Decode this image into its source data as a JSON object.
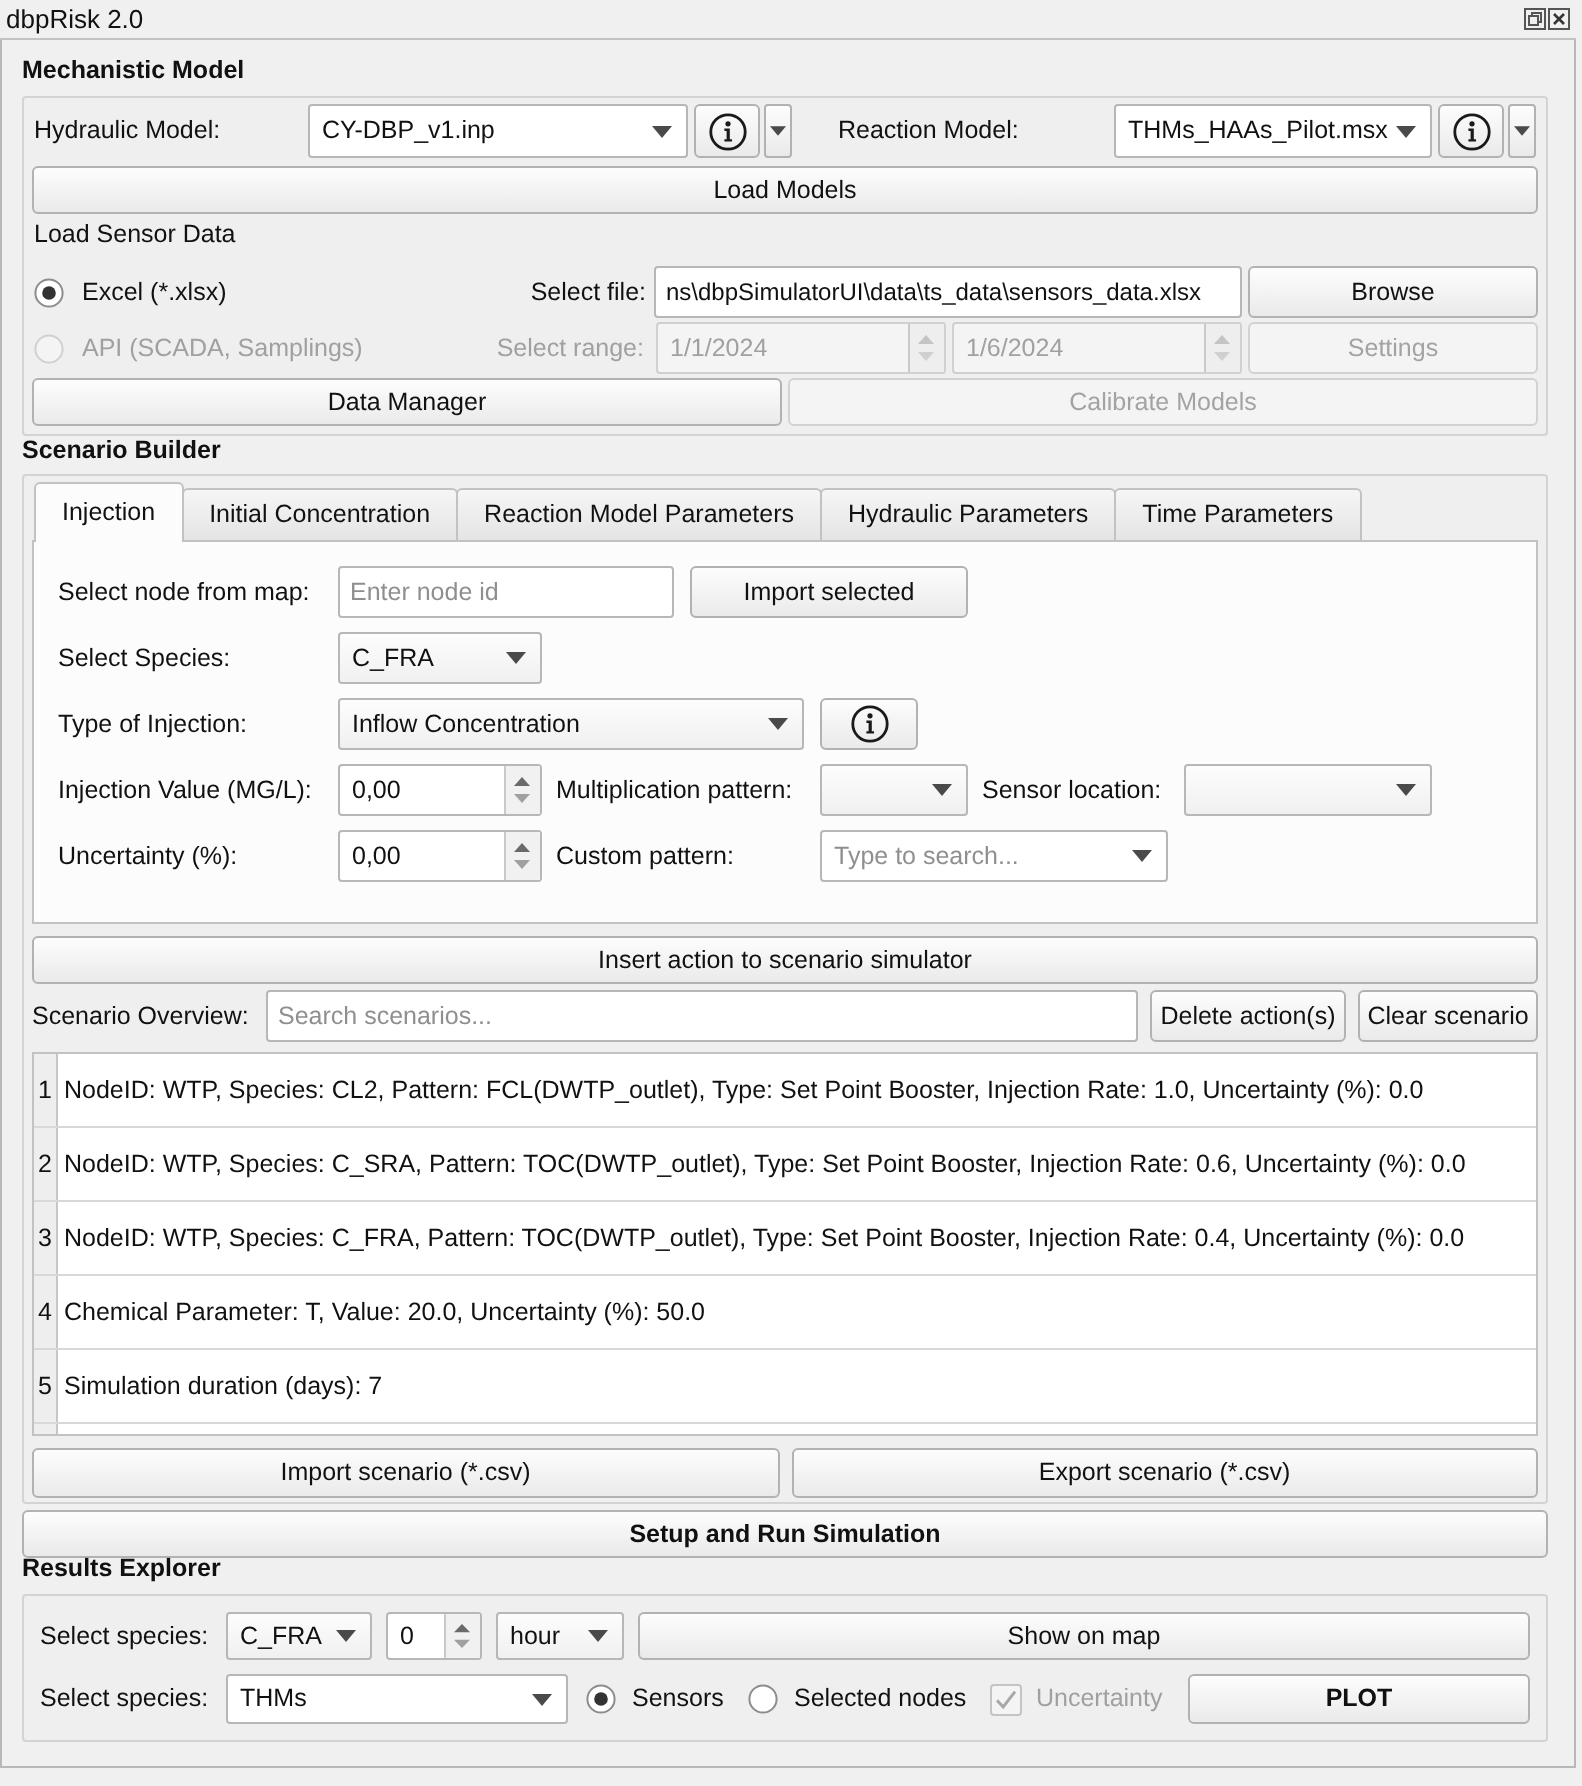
{
  "window": {
    "title": "dbpRisk 2.0"
  },
  "mechanistic_model": {
    "title": "Mechanistic Model",
    "hydraulic_model": {
      "label": "Hydraulic Model:",
      "value": "CY-DBP_v1.inp"
    },
    "reaction_model": {
      "label": "Reaction Model:",
      "value": "THMs_HAAs_Pilot.msx"
    },
    "load_button": "Load Models",
    "sensor_data": {
      "title": "Load Sensor Data",
      "sources": [
        {
          "label": "Excel (*.xlsx)",
          "selected": true,
          "disabled": false
        },
        {
          "label": "API (SCADA, Samplings)",
          "selected": false,
          "disabled": true
        }
      ],
      "file": {
        "label": "Select file:",
        "value": "ns\\dbpSimulatorUI\\data\\ts_data\\sensors_data.xlsx",
        "button": "Browse"
      },
      "range": {
        "label": "Select range:",
        "start": "1/1/2024",
        "end": "1/6/2024",
        "button": "Settings",
        "disabled": true
      }
    },
    "actions": [
      {
        "label": "Data Manager",
        "disabled": false
      },
      {
        "label": "Calibrate Models",
        "disabled": true
      }
    ]
  },
  "scenario_builder": {
    "title": "Scenario Builder",
    "tabs": [
      {
        "label": "Injection",
        "selected": true
      },
      {
        "label": "Initial Concentration",
        "selected": false
      },
      {
        "label": "Reaction Model Parameters",
        "selected": false
      },
      {
        "label": "Hydraulic Parameters",
        "selected": false
      },
      {
        "label": "Time Parameters",
        "selected": false
      }
    ],
    "injection": {
      "node": {
        "label": "Select node from map:",
        "placeholder": "Enter node id",
        "button": "Import selected"
      },
      "species": {
        "label": "Select Species:",
        "value": "C_FRA"
      },
      "injection_type": {
        "label": "Type of Injection:",
        "value": "Inflow Concentration"
      },
      "injection_value": {
        "label": "Injection Value (MG/L):",
        "value": "0,00"
      },
      "multiplication_pattern": {
        "label": "Multiplication pattern:"
      },
      "sensor_location": {
        "label": "Sensor location:"
      },
      "uncertainty": {
        "label": "Uncertainty (%):",
        "value": "0,00"
      },
      "custom_pattern": {
        "label": "Custom pattern:",
        "placeholder": "Type to search..."
      }
    },
    "insert_button": "Insert action to scenario simulator",
    "overview": {
      "label": "Scenario Overview:",
      "placeholder": "Search scenarios...",
      "delete_button": "Delete action(s)",
      "clear_button": "Clear scenario"
    },
    "rows": [
      {
        "number": "1",
        "text": "NodeID: WTP, Species: CL2, Pattern: FCL(DWTP_outlet), Type: Set Point Booster, Injection Rate: 1.0, Uncertainty (%): 0.0"
      },
      {
        "number": "2",
        "text": "NodeID: WTP, Species: C_SRA, Pattern: TOC(DWTP_outlet), Type: Set Point Booster, Injection Rate: 0.6, Uncertainty (%): 0.0"
      },
      {
        "number": "3",
        "text": "NodeID: WTP, Species: C_FRA, Pattern: TOC(DWTP_outlet), Type: Set Point Booster, Injection Rate: 0.4, Uncertainty (%): 0.0"
      },
      {
        "number": "4",
        "text": "Chemical Parameter: T, Value: 20.0, Uncertainty (%): 50.0"
      },
      {
        "number": "5",
        "text": "Simulation duration (days): 7"
      }
    ],
    "import_button": "Import scenario (*.csv)",
    "export_button": "Export scenario (*.csv)"
  },
  "run_button": "Setup and Run Simulation",
  "results_explorer": {
    "title": "Results Explorer",
    "map_row": {
      "label": "Select species:",
      "species": "C_FRA",
      "time_value": "0",
      "time_unit": "hour",
      "button": "Show on map"
    },
    "plot_row": {
      "label": "Select species:",
      "species": "THMs",
      "targets": [
        {
          "label": "Sensors",
          "selected": true
        },
        {
          "label": "Selected nodes",
          "selected": false
        }
      ],
      "uncertainty": {
        "label": "Uncertainty",
        "checked": true,
        "disabled": true
      },
      "button": "PLOT"
    }
  }
}
